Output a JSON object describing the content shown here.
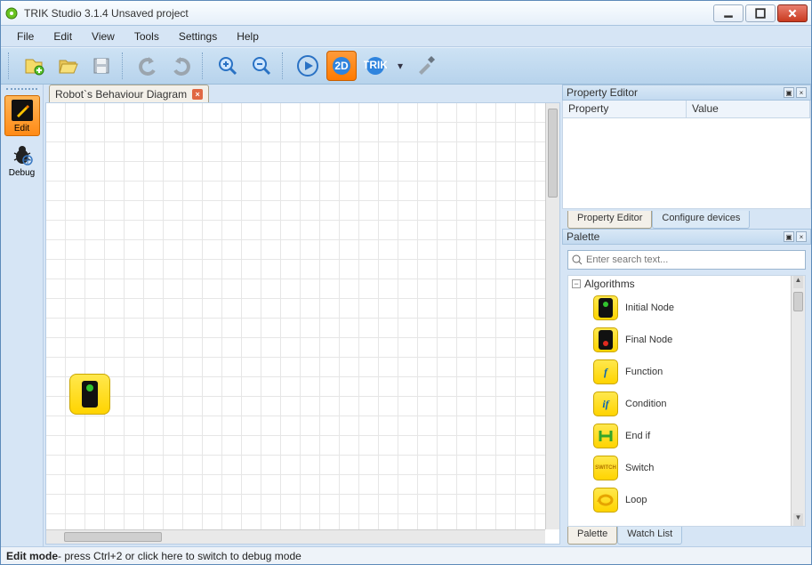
{
  "window": {
    "title": "TRIK Studio 3.1.4 Unsaved project"
  },
  "menubar": {
    "items": [
      "File",
      "Edit",
      "View",
      "Tools",
      "Settings",
      "Help"
    ]
  },
  "modes": {
    "edit": "Edit",
    "debug": "Debug"
  },
  "doc_tab": {
    "label": "Robot`s Behaviour Diagram"
  },
  "canvas": {
    "node_type": "initial-node"
  },
  "property_editor": {
    "title": "Property Editor",
    "columns": {
      "property": "Property",
      "value": "Value"
    },
    "tabs": {
      "editor": "Property Editor",
      "configure": "Configure devices"
    }
  },
  "palette": {
    "title": "Palette",
    "search_placeholder": "Enter search text...",
    "group_label": "Algorithms",
    "items": [
      {
        "label": "Initial Node",
        "icon": "initial"
      },
      {
        "label": "Final Node",
        "icon": "final"
      },
      {
        "label": "Function",
        "icon": "f"
      },
      {
        "label": "Condition",
        "icon": "if"
      },
      {
        "label": "End if",
        "icon": "endif"
      },
      {
        "label": "Switch",
        "icon": "switch"
      },
      {
        "label": "Loop",
        "icon": "loop"
      }
    ],
    "tabs": {
      "palette": "Palette",
      "watch": "Watch List"
    }
  },
  "statusbar": {
    "mode": "Edit mode",
    "hint": " - press Ctrl+2 or click here to switch to debug mode"
  }
}
